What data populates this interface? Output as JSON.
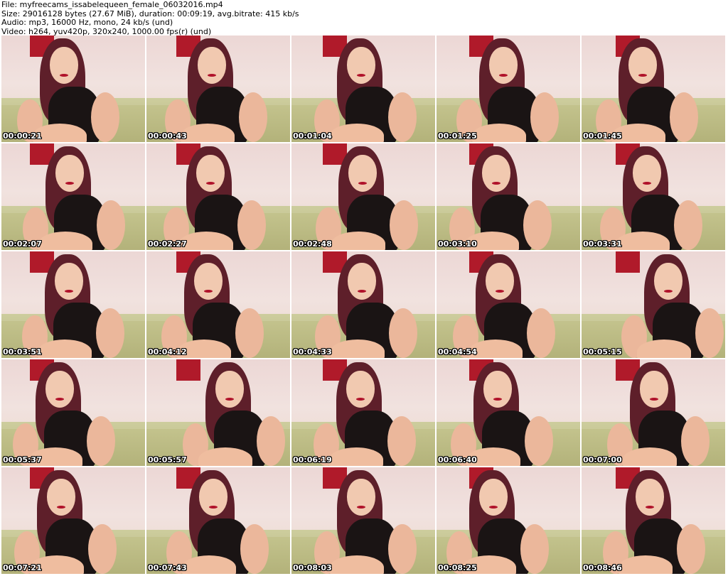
{
  "header": {
    "file_line": "File: myfreecams_issabelequeen_female_06032016.mp4",
    "size_line": "Size: 29016128 bytes (27.67 MiB), duration: 00:09:19, avg.bitrate: 415 kb/s",
    "audio_line": "Audio: mp3, 16000 Hz, mono, 24 kb/s (und)",
    "video_line": "Video: h264, yuv420p, 320x240, 1000.00 fps(r) (und)"
  },
  "thumbnails": [
    {
      "timestamp": "00:00:21"
    },
    {
      "timestamp": "00:00:43"
    },
    {
      "timestamp": "00:01:04"
    },
    {
      "timestamp": "00:01:25"
    },
    {
      "timestamp": "00:01:45"
    },
    {
      "timestamp": "00:02:07"
    },
    {
      "timestamp": "00:02:27"
    },
    {
      "timestamp": "00:02:48"
    },
    {
      "timestamp": "00:03:10"
    },
    {
      "timestamp": "00:03:31"
    },
    {
      "timestamp": "00:03:51"
    },
    {
      "timestamp": "00:04:12"
    },
    {
      "timestamp": "00:04:33"
    },
    {
      "timestamp": "00:04:54"
    },
    {
      "timestamp": "00:05:15"
    },
    {
      "timestamp": "00:05:37"
    },
    {
      "timestamp": "00:05:57"
    },
    {
      "timestamp": "00:06:19"
    },
    {
      "timestamp": "00:06:40"
    },
    {
      "timestamp": "00:07:00"
    },
    {
      "timestamp": "00:07:21"
    },
    {
      "timestamp": "00:07:43"
    },
    {
      "timestamp": "00:08:03"
    },
    {
      "timestamp": "00:08:25"
    },
    {
      "timestamp": "00:08:46"
    }
  ]
}
